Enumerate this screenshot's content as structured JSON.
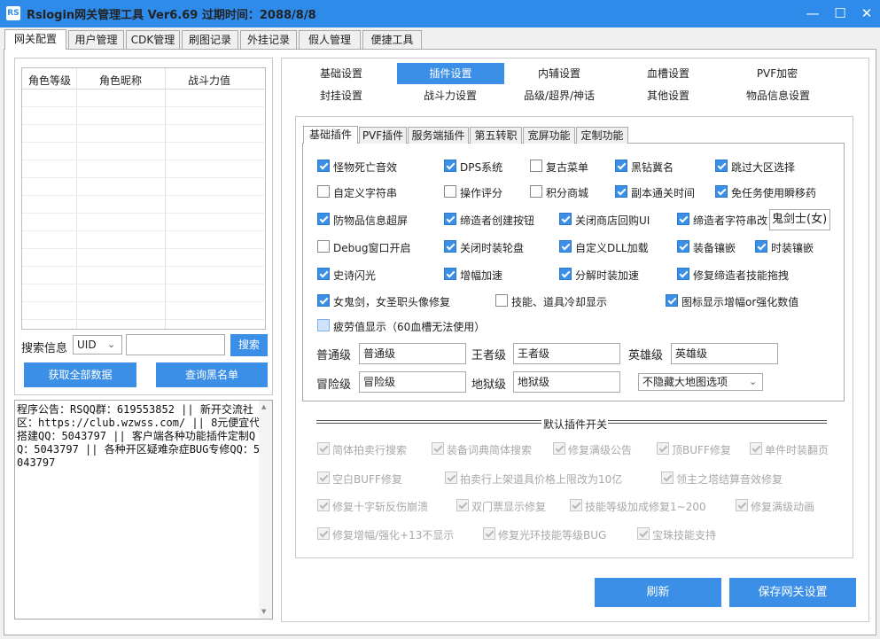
{
  "window": {
    "title": "Rslogin网关管理工具 Ver6.69 过期时间：2088/8/8",
    "logo_text": "RS",
    "min": "—",
    "max": "☐",
    "close": "✕"
  },
  "main_tabs": [
    "网关配置",
    "用户管理",
    "CDK管理",
    "刷图记录",
    "外挂记录",
    "假人管理",
    "便捷工具"
  ],
  "left": {
    "grid_headers": [
      "角色等级",
      "角色昵称",
      "战斗力值"
    ],
    "search_label": "搜索信息",
    "search_type": "UID",
    "search_value": "",
    "search_button": "搜索",
    "fetch_button": "获取全部数据",
    "blacklist_button": "查询黑名单",
    "notice": "程序公告：RSQQ群：619553852 || 新开交流社区：https://club.wzwss.com/ || 8元便宜代搭建QQ：5043797 || 客户端各种功能插件定制QQ：5043797 || 各种开区疑难杂症BUG专修QQ：5043797"
  },
  "settings_tabs_row1": [
    "基础设置",
    "插件设置",
    "内辅设置",
    "血槽设置",
    "PVF加密"
  ],
  "settings_tabs_row2": [
    "封挂设置",
    "战斗力设置",
    "品级/超界/神话",
    "其他设置",
    "物品信息设置"
  ],
  "inner_tabs": [
    "基础插件",
    "PVF插件",
    "服务端插件",
    "第五转职",
    "宽屏功能",
    "定制功能"
  ],
  "plugins": [
    {
      "label": "怪物死亡音效",
      "checked": true
    },
    {
      "label": "DPS系统",
      "checked": true
    },
    {
      "label": "复古菜单",
      "checked": false
    },
    {
      "label": "黑钻冀名",
      "checked": true
    },
    {
      "label": "跳过大区选择",
      "checked": true
    },
    {
      "label": "自定义字符串",
      "checked": false
    },
    {
      "label": "操作评分",
      "checked": false
    },
    {
      "label": "积分商城",
      "checked": false
    },
    {
      "label": "副本通关时间",
      "checked": true
    },
    {
      "label": "免任务使用瞬移药",
      "checked": true
    },
    {
      "label": "防物品信息超屏",
      "checked": true
    },
    {
      "label": "缔造者创建按钮",
      "checked": true
    },
    {
      "label": "关闭商店回购UI",
      "checked": true
    },
    {
      "label": "缔造者字符串改",
      "checked": true
    },
    {
      "label": "Debug窗口开启",
      "checked": false
    },
    {
      "label": "关闭时装轮盘",
      "checked": true
    },
    {
      "label": "自定义DLL加载",
      "checked": true
    },
    {
      "label": "装备镶嵌",
      "checked": true
    },
    {
      "label": "时装镶嵌",
      "checked": true
    },
    {
      "label": "史诗闪光",
      "checked": true
    },
    {
      "label": "增幅加速",
      "checked": true
    },
    {
      "label": "分解时装加速",
      "checked": true
    },
    {
      "label": "修复缔造者技能拖拽",
      "checked": true
    },
    {
      "label": "女鬼剑，女圣职头像修复",
      "checked": true
    },
    {
      "label": "技能、道具冷却显示",
      "checked": false
    },
    {
      "label": "图标显示增幅or强化数值",
      "checked": true
    },
    {
      "label": "疲劳值显示（60血槽无法使用）",
      "checked": false
    }
  ],
  "creator_string": "鬼剑士(女)",
  "grades": [
    {
      "label": "普通级",
      "value": "普通级"
    },
    {
      "label": "王者级",
      "value": "王者级"
    },
    {
      "label": "英雄级",
      "value": "英雄级"
    },
    {
      "label": "冒险级",
      "value": "冒险级"
    },
    {
      "label": "地狱级",
      "value": "地狱级"
    }
  ],
  "map_option": "不隐藏大地图选项",
  "default_section": "默认插件开关",
  "defaults": [
    {
      "label": "简体拍卖行搜索",
      "checked": true
    },
    {
      "label": "装备词典简体搜索",
      "checked": true
    },
    {
      "label": "修复满级公告",
      "checked": true
    },
    {
      "label": "顶BUFF修复",
      "checked": true
    },
    {
      "label": "单件时装翻页",
      "checked": true
    },
    {
      "label": "空白BUFF修复",
      "checked": true
    },
    {
      "label": "拍卖行上架道具价格上限改为10亿",
      "checked": true
    },
    {
      "label": "领主之塔结算音效修复",
      "checked": true
    },
    {
      "label": "修复十字斩反伤崩溃",
      "checked": true
    },
    {
      "label": "双门票显示修复",
      "checked": true
    },
    {
      "label": "技能等级加成修复1~200",
      "checked": true
    },
    {
      "label": "修复满级动画",
      "checked": true
    },
    {
      "label": "修复增幅/强化+13不显示",
      "checked": true
    },
    {
      "label": "修复光环技能等级BUG",
      "checked": true
    },
    {
      "label": "宝珠技能支持",
      "checked": true
    }
  ],
  "refresh_button": "刷新",
  "save_button": "保存网关设置",
  "colors": {
    "accent": "#3b8fe6",
    "titlebar": "#2e8bea",
    "window_bg": "#f0f0f0"
  }
}
